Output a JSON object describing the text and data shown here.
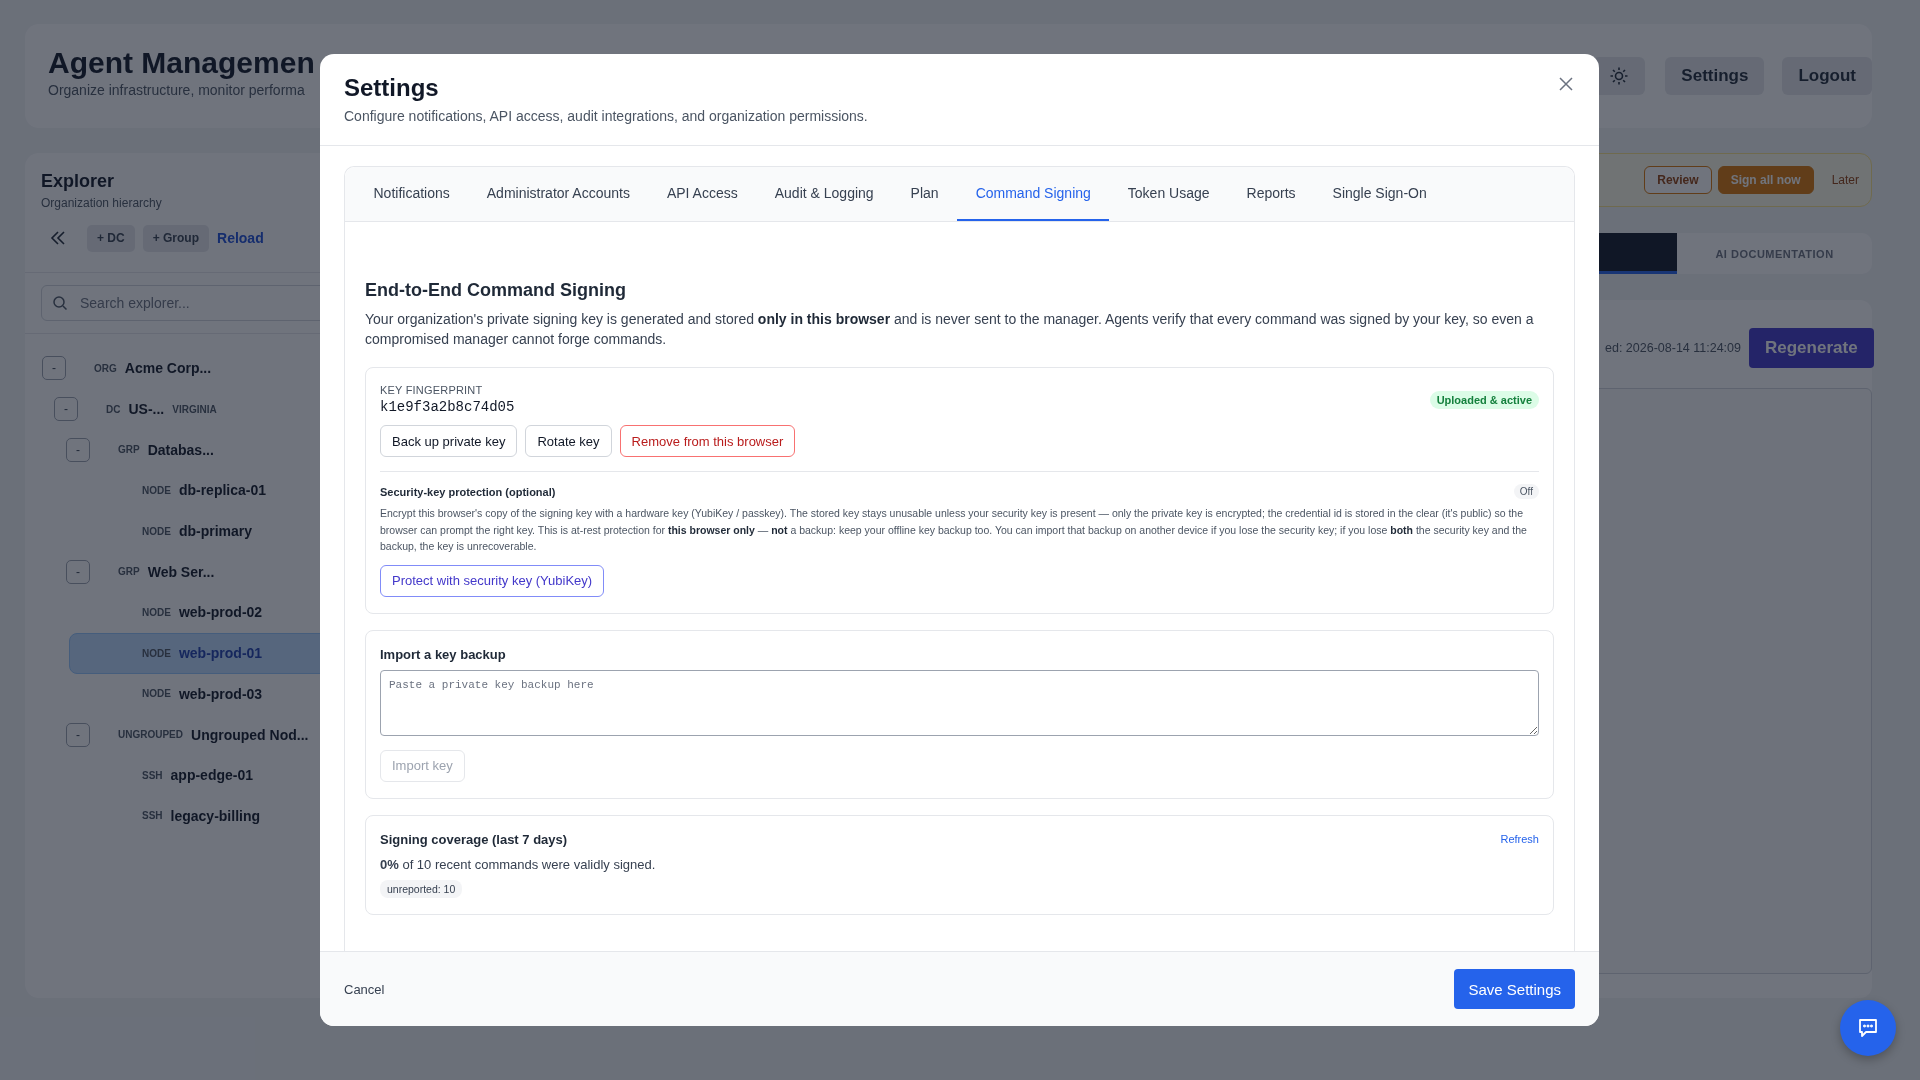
{
  "app": {
    "title": "Agent Managemen",
    "subtitle": "Organize infrastructure, monitor performa",
    "header_buttons": [
      "Settings",
      "Logout"
    ]
  },
  "explorer": {
    "title": "Explorer",
    "subtitle": "Organization hierarchy",
    "toolbar": [
      "+ DC",
      "+ Group"
    ],
    "reload": "Reload",
    "search": {
      "placeholder": "Search explorer..."
    },
    "tree": [
      {
        "toggle": "-",
        "type": "ORG",
        "label": "Acme Corp...",
        "selected": false,
        "children": [
          {
            "toggle": "-",
            "type": "DC",
            "label": "US-...",
            "region": "VIRGINIA",
            "selected": false,
            "children": [
              {
                "toggle": "-",
                "type": "GRP",
                "label": "Databas...",
                "selected": false,
                "children": [
                  {
                    "type": "NODE",
                    "label": "db-replica-01",
                    "selected": false
                  },
                  {
                    "type": "NODE",
                    "label": "db-primary",
                    "selected": false
                  }
                ]
              },
              {
                "toggle": "-",
                "type": "GRP",
                "label": "Web Ser...",
                "selected": false,
                "children": [
                  {
                    "type": "NODE",
                    "label": "web-prod-02",
                    "selected": false
                  },
                  {
                    "type": "NODE",
                    "label": "web-prod-01",
                    "selected": true
                  },
                  {
                    "type": "NODE",
                    "label": "web-prod-03",
                    "selected": false
                  }
                ]
              },
              {
                "toggle": "-",
                "type": "UNGROUPED",
                "label": "Ungrouped Nod...",
                "selected": false,
                "children": [
                  {
                    "type": "SSH",
                    "label": "app-edge-01",
                    "selected": false
                  },
                  {
                    "type": "SSH",
                    "label": "legacy-billing",
                    "selected": false
                  }
                ]
              }
            ]
          }
        ]
      }
    ]
  },
  "banner": {
    "buttons": [
      {
        "label": "Review",
        "kind": "outline"
      },
      {
        "label": "Sign all now",
        "kind": "primary"
      },
      {
        "label": "Later",
        "kind": "link"
      }
    ]
  },
  "view_tabs": [
    {
      "selected": true
    },
    {
      "label": "AI DOCUMENTATION",
      "selected": false
    }
  ],
  "doc_panel": {
    "generated": "ed: 2026-08-14 11:24:09",
    "button": "Regenerate"
  },
  "modal": {
    "title": "Settings",
    "subtitle": "Configure notifications, API access, audit integrations, and organization permissions.",
    "tabs": [
      {
        "label": "Notifications",
        "selected": false
      },
      {
        "label": "Administrator Accounts",
        "selected": false
      },
      {
        "label": "API Access",
        "selected": false
      },
      {
        "label": "Audit & Logging",
        "selected": false
      },
      {
        "label": "Plan",
        "selected": false
      },
      {
        "label": "Command Signing",
        "selected": true
      },
      {
        "label": "Token Usage",
        "selected": false
      },
      {
        "label": "Reports",
        "selected": false
      },
      {
        "label": "Single Sign-On",
        "selected": false
      }
    ],
    "heading": "End-to-End Command Signing",
    "description": "Your organization's private signing key is generated and stored **only in this browser** and is never sent to the manager. Agents verify that every command was signed by your key, so even a compromised manager cannot forge commands.",
    "key_card": {
      "label": "KEY FINGERPRINT",
      "fingerprint": "k1e9f3a2b8c74d05",
      "status": "Uploaded & active",
      "buttons": [
        {
          "label": "Back up private key",
          "kind": "default"
        },
        {
          "label": "Rotate key",
          "kind": "default"
        },
        {
          "label": "Remove from this browser",
          "kind": "danger"
        }
      ],
      "protection": {
        "title": "Security-key protection (optional)",
        "state": "Off",
        "on": false,
        "text": "Encrypt this browser's copy of the signing key with a hardware key (YubiKey / passkey). The stored key stays unusable unless your security key is present — only the private key is encrypted; the credential id is stored in the clear (it's public) so the browser can prompt the right key. This is at-rest protection for **this browser only** — **not** a backup: keep your offline key backup too. You can import that backup on another device if you lose the security key; if you lose **both** the security key and the backup, the key is unrecoverable.",
        "button": "Protect with security key (YubiKey)"
      }
    },
    "import_card": {
      "title": "Import a key backup",
      "placeholder": "Paste a private key backup here",
      "button": {
        "label": "Import key",
        "disabled": true
      }
    },
    "coverage": {
      "title": "Signing coverage (last 7 days)",
      "refresh": "Refresh",
      "summary": "**0%** of 10 recent commands were validly signed.",
      "tags": [
        "unreported: 10"
      ]
    },
    "footer": {
      "cancel": "Cancel",
      "save": "Save Settings"
    }
  }
}
